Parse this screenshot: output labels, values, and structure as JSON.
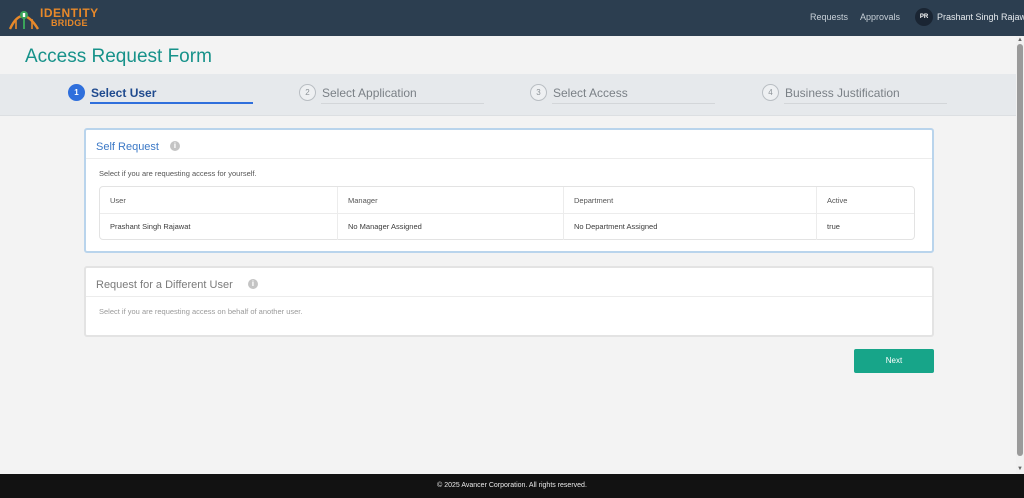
{
  "header": {
    "logo_line1": "IDENTITY",
    "logo_line2": "BRIDGE",
    "nav": {
      "requests": "Requests",
      "approvals": "Approvals"
    },
    "user": {
      "initials": "PR",
      "name": "Prashant Singh Rajawat"
    }
  },
  "page": {
    "title": "Access Request Form"
  },
  "stepper": {
    "steps": [
      {
        "number": "1",
        "label": "Select User",
        "active": true
      },
      {
        "number": "2",
        "label": "Select Application",
        "active": false
      },
      {
        "number": "3",
        "label": "Select Access",
        "active": false
      },
      {
        "number": "4",
        "label": "Business Justification",
        "active": false
      }
    ]
  },
  "self_request": {
    "title": "Self Request",
    "info_icon": "info-icon",
    "description": "Select if you are requesting access for yourself.",
    "table": {
      "headers": [
        "User",
        "Manager",
        "Department",
        "Active"
      ],
      "rows": [
        [
          "Prashant Singh Rajawat",
          "No Manager Assigned",
          "No Department Assigned",
          "true"
        ]
      ]
    }
  },
  "other_request": {
    "title": "Request for a Different User",
    "info_icon": "info-icon",
    "description": "Select if you are requesting access on behalf of another user."
  },
  "actions": {
    "next_label": "Next"
  },
  "footer": {
    "text": "© 2025 Avancer Corporation. All rights reserved."
  },
  "colors": {
    "topbar": "#2c3e50",
    "title": "#17928a",
    "active_step": "#2f6fdc",
    "next_button": "#17a589",
    "footer": "#121212",
    "logo": "#e8892a"
  }
}
